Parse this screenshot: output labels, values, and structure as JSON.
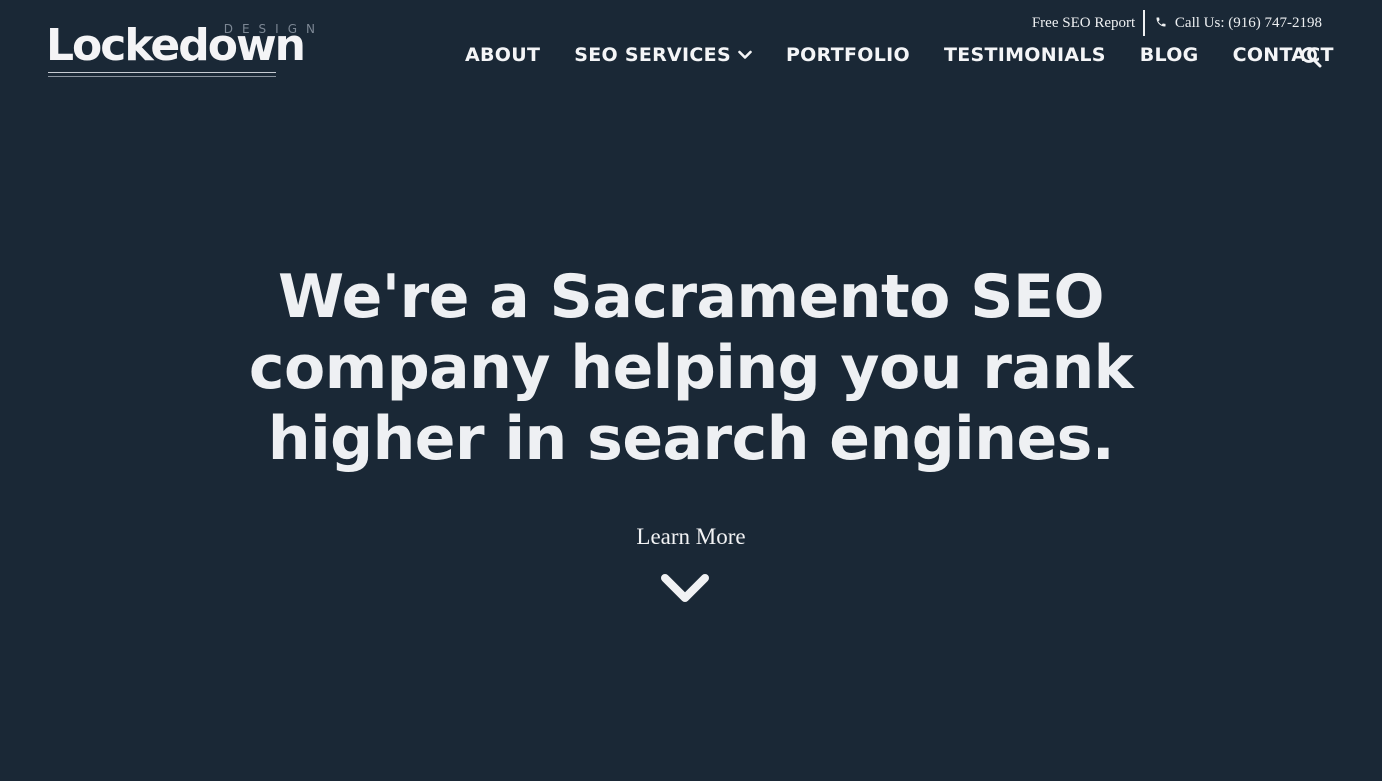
{
  "logo": {
    "wordmark": "Lockedown",
    "subtext": "DESIGN"
  },
  "utility": {
    "free_report": "Free SEO Report",
    "call_us": "Call Us: (916) 747-2198",
    "phone_icon": "phone-icon"
  },
  "nav": {
    "items": [
      {
        "label": "ABOUT"
      },
      {
        "label": "SEO SERVICES",
        "has_dropdown": true
      },
      {
        "label": "PORTFOLIO"
      },
      {
        "label": "TESTIMONIALS"
      },
      {
        "label": "BLOG"
      },
      {
        "label": "CONTACT"
      }
    ],
    "search_icon": "search-icon"
  },
  "hero": {
    "title": "We're a Sacramento SEO company helping you rank higher in search engines.",
    "learn_more": "Learn More",
    "arrow_icon": "chevron-down-icon"
  },
  "colors": {
    "background": "#1a2836",
    "text": "#f1f2f4",
    "logo_subtext": "#7c8794"
  }
}
